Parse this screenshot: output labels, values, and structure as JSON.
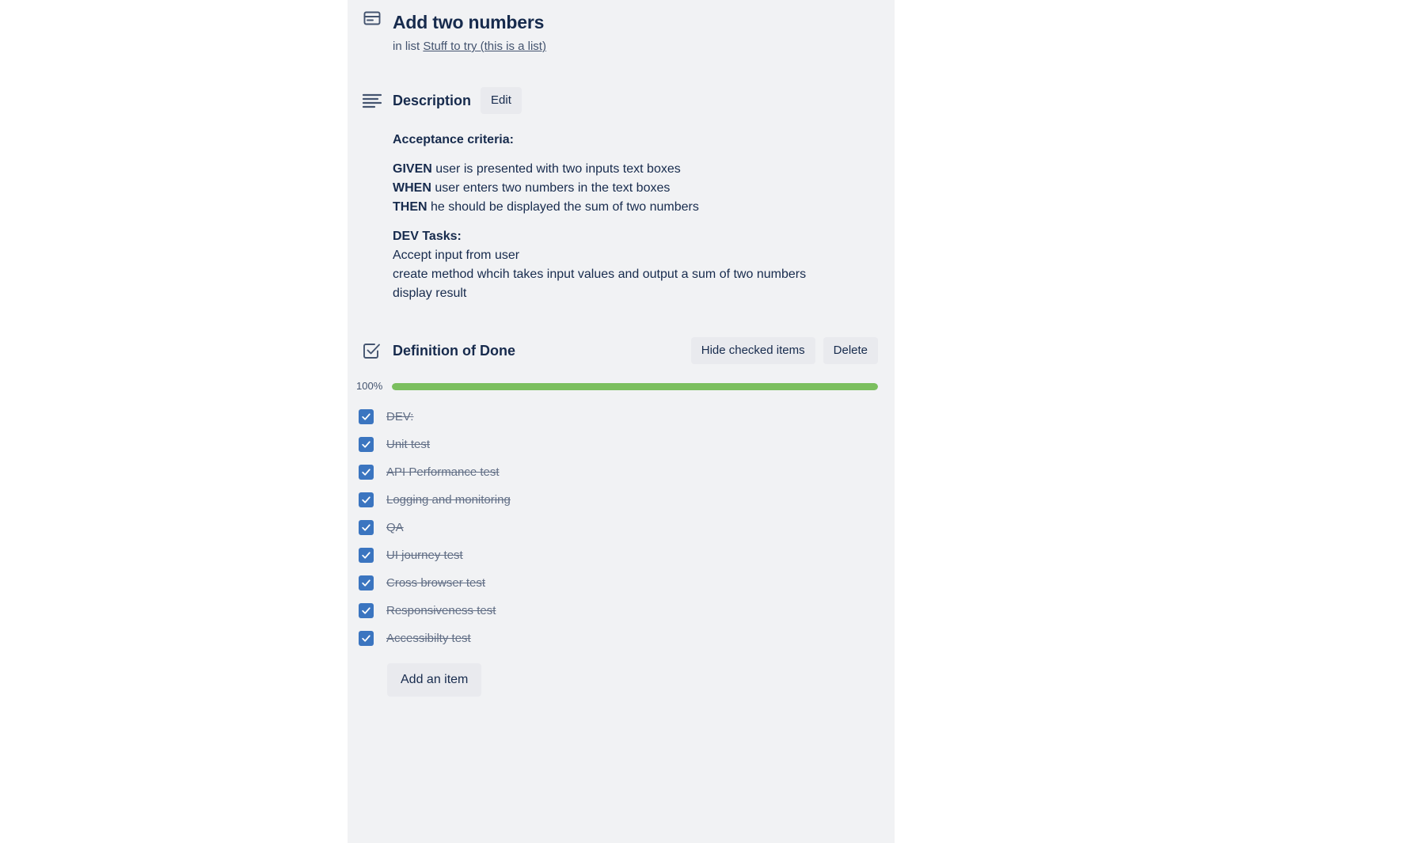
{
  "card": {
    "title": "Add two numbers",
    "in_list_prefix": "in list",
    "list_name": "Stuff to try (this is a list)",
    "header_icon": "card-window-icon"
  },
  "description": {
    "icon": "description-lines-icon",
    "title": "Description",
    "edit_label": "Edit",
    "blocks": [
      {
        "heading": "Acceptance criteria:"
      },
      {
        "lines": [
          {
            "bold": "GIVEN",
            "rest": " user is presented with two inputs text boxes"
          },
          {
            "bold": "WHEN",
            "rest": " user enters two numbers in the text boxes"
          },
          {
            "bold": "THEN",
            "rest": " he should be displayed the sum of two numbers"
          }
        ]
      },
      {
        "heading": "DEV Tasks:",
        "lines": [
          {
            "bold": "",
            "rest": "Accept input from user"
          },
          {
            "bold": "",
            "rest": "create method whcih takes input values and output a sum of two numbers"
          },
          {
            "bold": "",
            "rest": "display result"
          }
        ]
      }
    ],
    "acceptance_heading": "Acceptance criteria:",
    "given_bold": "GIVEN",
    "given_text": " user is presented with two inputs text boxes",
    "when_bold": "WHEN",
    "when_text": " user enters two numbers in the text boxes",
    "then_bold": "THEN",
    "then_text": " he should be displayed the sum of two numbers",
    "dev_heading": "DEV Tasks:",
    "dev_line_1": "Accept input from user",
    "dev_line_2": "create method whcih takes input values and output a sum of two numbers",
    "dev_line_3": "display result"
  },
  "checklist": {
    "icon": "checklist-checkbox-icon",
    "title": "Definition of Done",
    "hide_checked_label": "Hide checked items",
    "delete_label": "Delete",
    "progress_percent_label": "100%",
    "progress_percent_value": 100,
    "progress_fill_color": "#7bbf5e",
    "progress_track_color": "#dcdfe4",
    "checkbox_color": "#3b75c0",
    "items": [
      {
        "label": "DEV:",
        "checked": true
      },
      {
        "label": "Unit test",
        "checked": true
      },
      {
        "label": "API Performance test",
        "checked": true
      },
      {
        "label": "Logging and monitoring",
        "checked": true
      },
      {
        "label": "QA",
        "checked": true
      },
      {
        "label": "UI journey test",
        "checked": true
      },
      {
        "label": "Cross browser test",
        "checked": true
      },
      {
        "label": "Responsiveness test",
        "checked": true
      },
      {
        "label": "Accessibilty test",
        "checked": true
      }
    ],
    "add_item_label": "Add an item"
  }
}
